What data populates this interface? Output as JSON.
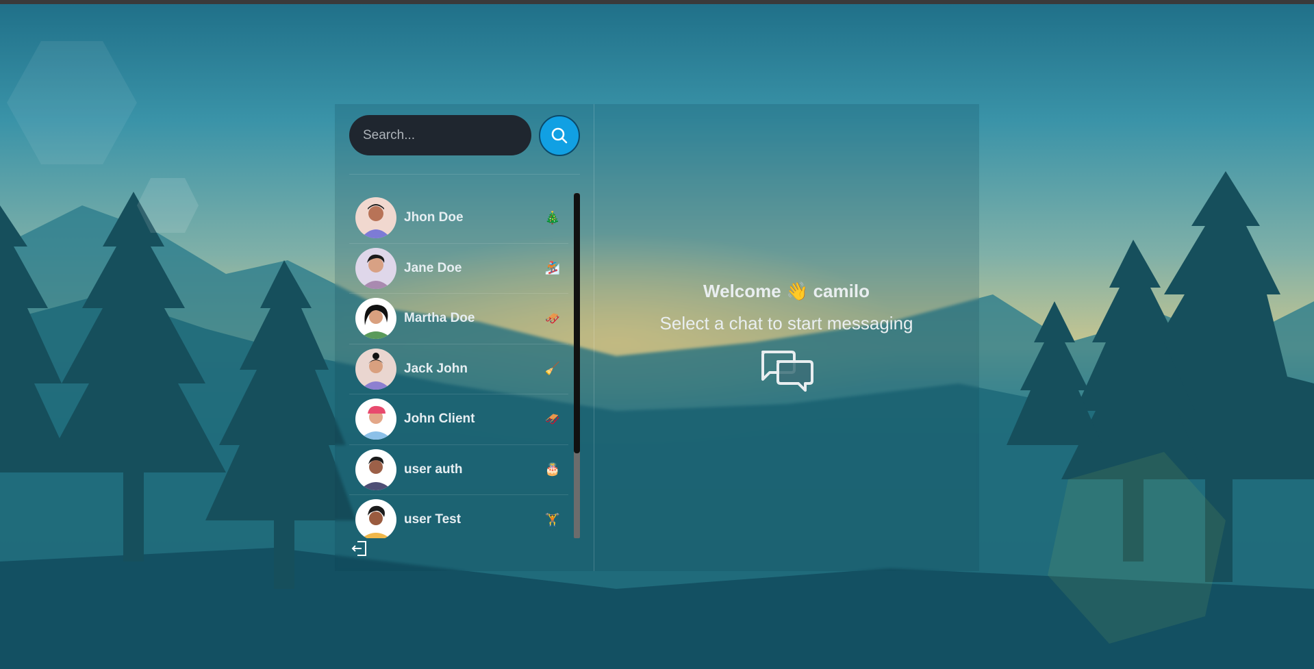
{
  "search": {
    "placeholder": "Search...",
    "button_icon": "search-icon"
  },
  "contacts": [
    {
      "name": "Jhon Doe",
      "emoji": "🎄"
    },
    {
      "name": "Jane Doe",
      "emoji": "🏂"
    },
    {
      "name": "Martha Doe",
      "emoji": "🛷"
    },
    {
      "name": "Jack John",
      "emoji": "🧹"
    },
    {
      "name": "John Client",
      "emoji": "🛷"
    },
    {
      "name": "user auth",
      "emoji": "🎂"
    },
    {
      "name": "user Test",
      "emoji": "🏋"
    }
  ],
  "welcome": {
    "greeting": "Welcome",
    "wave": "👋",
    "username": "camilo",
    "subtitle": "Select a chat to start messaging"
  },
  "icons": {
    "logout": "logout-icon",
    "chat": "chat-bubbles-icon"
  },
  "colors": {
    "accent": "#11a0e3",
    "search_bg": "#1f262f"
  }
}
